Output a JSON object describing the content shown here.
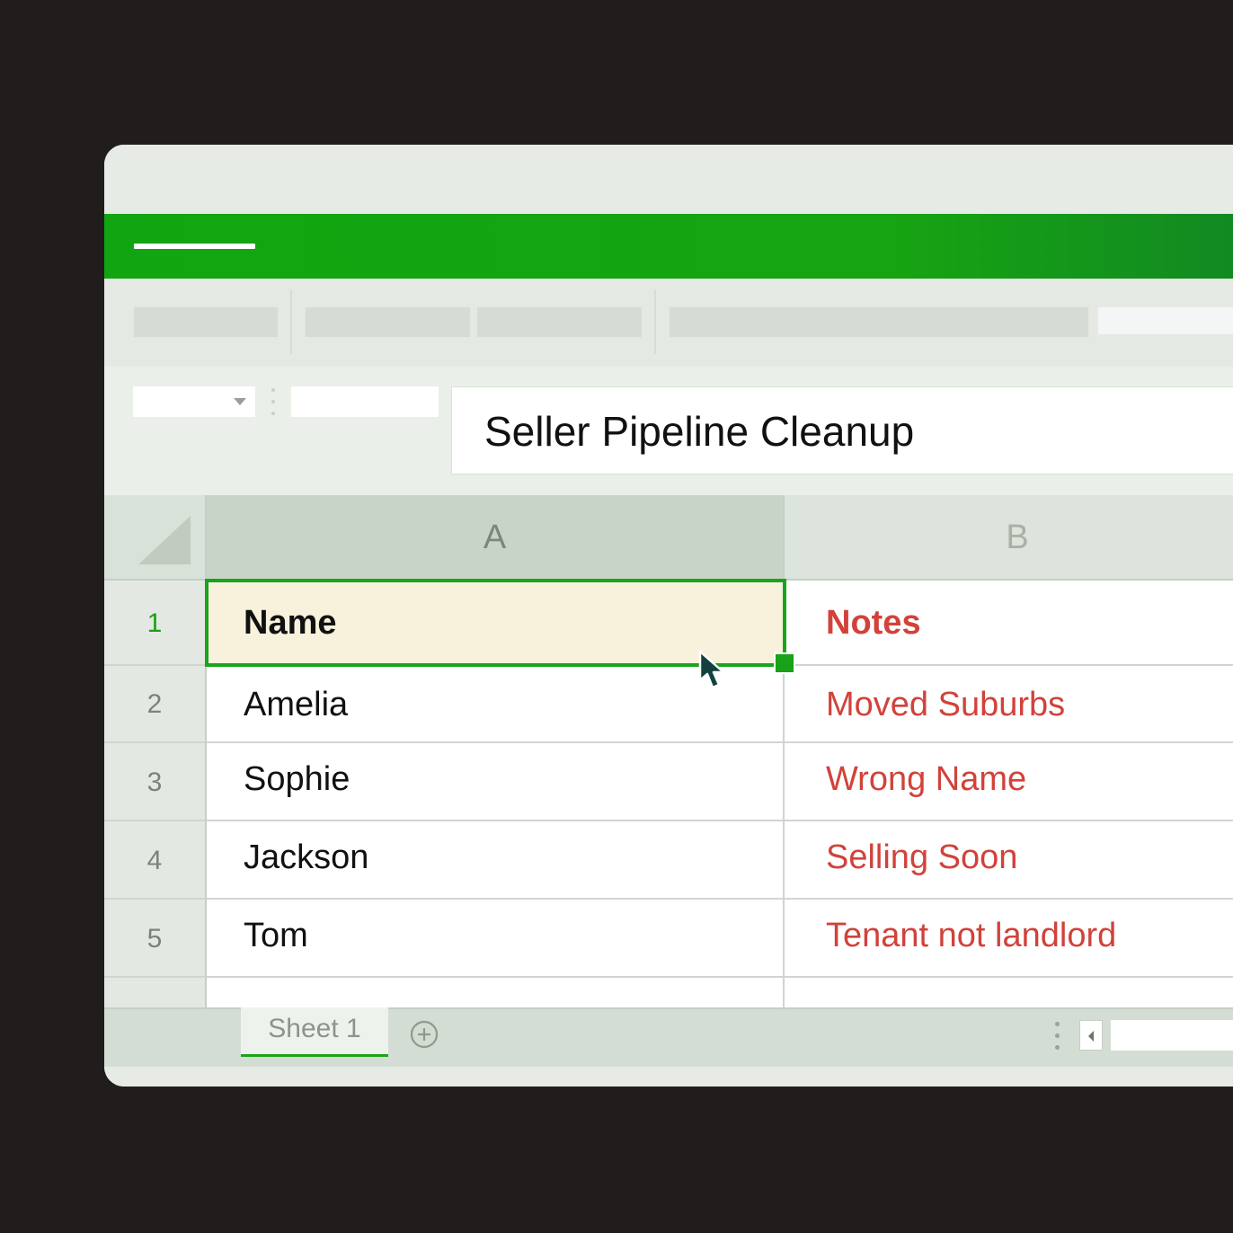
{
  "formula_bar": {
    "value": "Seller Pipeline Cleanup"
  },
  "columns": [
    "A",
    "B"
  ],
  "rows": [
    {
      "num": "1",
      "name": "Name",
      "notes": "Notes"
    },
    {
      "num": "2",
      "name": "Amelia",
      "notes": "Moved Suburbs"
    },
    {
      "num": "3",
      "name": "Sophie",
      "notes": "Wrong Name"
    },
    {
      "num": "4",
      "name": "Jackson",
      "notes": "Selling Soon"
    },
    {
      "num": "5",
      "name": "Tom",
      "notes": "Tenant not landlord"
    }
  ],
  "sheet_tabs": [
    "Sheet 1"
  ],
  "colors": {
    "brand_green": "#16a412",
    "notes_red": "#d1423a",
    "selected_fill": "#f8f2dc"
  },
  "icons": {
    "add_sheet": "plus-circle-icon",
    "cursor": "mouse-pointer-icon"
  }
}
